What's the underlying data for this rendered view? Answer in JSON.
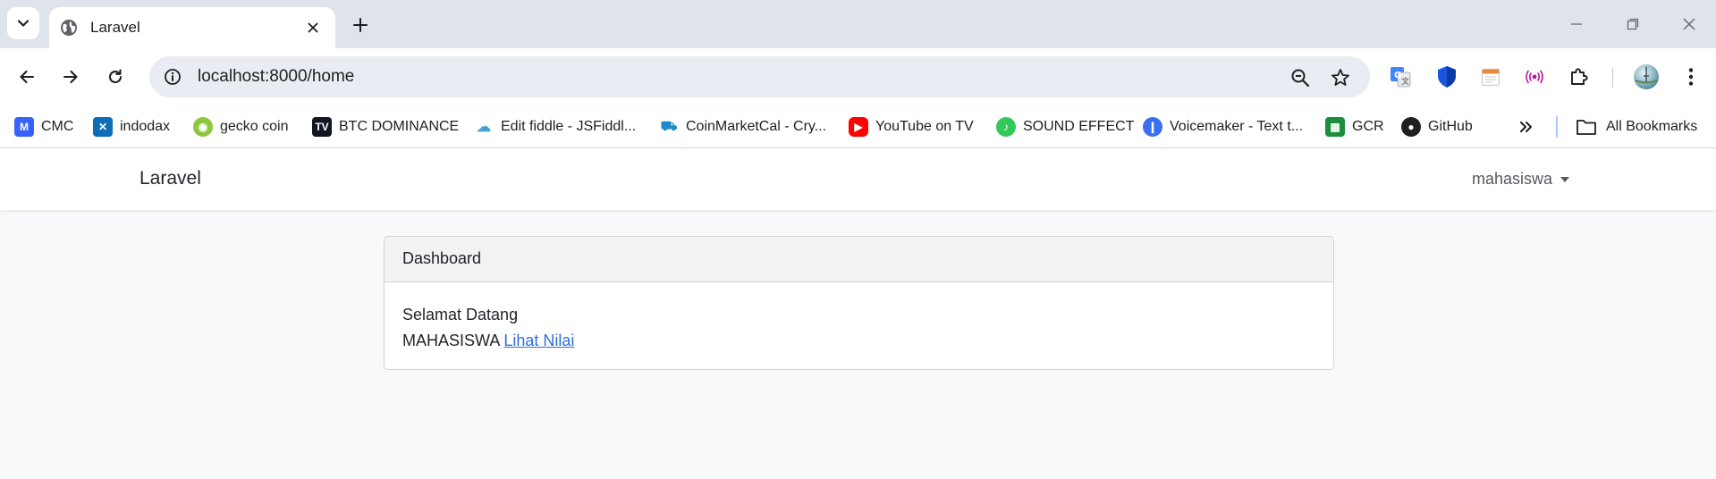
{
  "browser": {
    "tab": {
      "title": "Laravel"
    },
    "address_bar": {
      "url": "localhost:8000/home"
    },
    "bookmarks": [
      {
        "label": "CMC",
        "icon": "coinmarketcap-icon"
      },
      {
        "label": "indodax",
        "icon": "indodax-icon"
      },
      {
        "label": "gecko coin",
        "icon": "coingecko-icon"
      },
      {
        "label": "BTC DOMINANCE",
        "icon": "tradingview-icon"
      },
      {
        "label": "Edit fiddle - JSFiddl...",
        "icon": "jsfiddle-icon"
      },
      {
        "label": "CoinMarketCal - Cry...",
        "icon": "coinmarketcal-icon"
      },
      {
        "label": "YouTube on TV",
        "icon": "youtube-icon"
      },
      {
        "label": "SOUND EFFECT",
        "icon": "music-note-icon"
      },
      {
        "label": "Voicemaker - Text t...",
        "icon": "voicemaker-icon"
      },
      {
        "label": "GCR",
        "icon": "google-classroom-icon"
      },
      {
        "label": "GitHub",
        "icon": "github-icon"
      }
    ],
    "all_bookmarks_label": "All Bookmarks"
  },
  "app": {
    "brand": "Laravel",
    "user": "mahasiswa",
    "card": {
      "header": "Dashboard",
      "welcome": "Selamat Datang",
      "role": "MAHASISWA",
      "link_label": "Lihat Nilai"
    }
  },
  "colors": {
    "tabstrip_bg": "#dfe3eb",
    "page_bg": "#f8f9fa",
    "link": "#2f6fd6"
  }
}
